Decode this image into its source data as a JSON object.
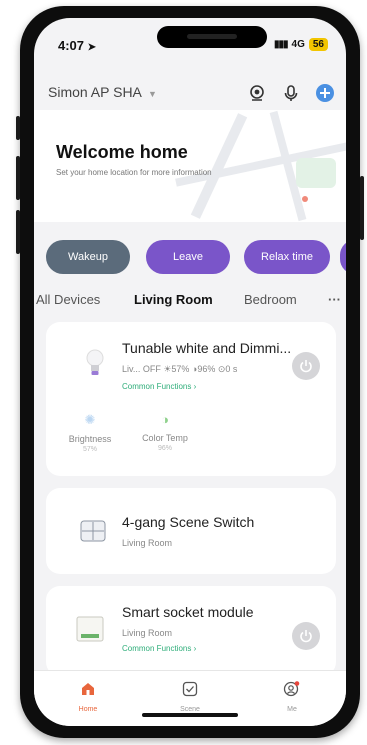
{
  "status_bar": {
    "time": "4:07",
    "signal": "4G",
    "battery": "56"
  },
  "header": {
    "home_name": "Simon AP SHA"
  },
  "welcome": {
    "title": "Welcome home",
    "subtitle": "Set your home location for more information"
  },
  "scenes": [
    {
      "label": "Wakeup",
      "color": "#5b6b7b"
    },
    {
      "label": "Leave",
      "color": "#7a55c9"
    },
    {
      "label": "Relax time",
      "color": "#7a55c9"
    }
  ],
  "tabs": [
    {
      "label": "All Devices"
    },
    {
      "label": "Living Room"
    },
    {
      "label": "Bedroom"
    },
    {
      "label": "···"
    }
  ],
  "devices": [
    {
      "name": "Tunable white and Dimmi...",
      "status": "Liv... OFF ☀57% ◑96% ⊙0 s",
      "link": "Common Functions ›",
      "functions": [
        {
          "label": "Brightness",
          "value": "57%"
        },
        {
          "label": "Color Temp",
          "value": "96%"
        }
      ]
    },
    {
      "name": "4-gang Scene Switch",
      "room": "Living Room"
    },
    {
      "name": "Smart socket module",
      "room": "Living Room",
      "link": "Common Functions ›"
    }
  ],
  "tabbar": [
    {
      "label": "Home",
      "icon": "home-icon"
    },
    {
      "label": "Scene",
      "icon": "scene-icon"
    },
    {
      "label": "Me",
      "icon": "user-icon"
    }
  ],
  "colors": {
    "accent": "#e8663c",
    "purple": "#7a55c9",
    "gray_pill": "#5b6b7b",
    "green": "#2fae7a",
    "blue": "#4a90e2"
  }
}
